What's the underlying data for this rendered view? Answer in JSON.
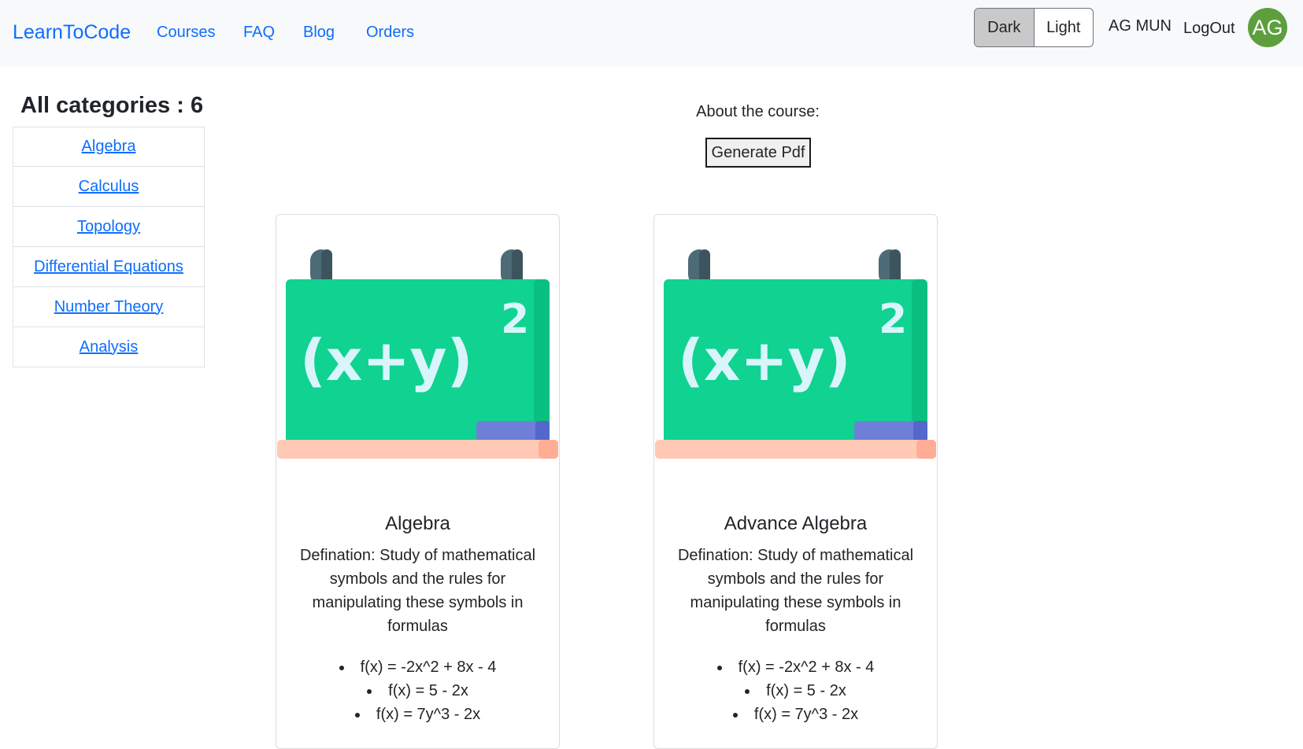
{
  "navbar": {
    "brand": "LearnToCode",
    "links": [
      "Courses",
      "FAQ",
      "Blog",
      "Orders"
    ],
    "theme_toggle": {
      "dark": "Dark",
      "light": "Light",
      "active": "Dark"
    },
    "user_name": "AG MUN",
    "logout": "LogOut",
    "avatar_initials": "AG",
    "avatar_color": "#5d9f3d"
  },
  "sidebar": {
    "title": "All categories : 6",
    "categories": [
      "Algebra",
      "Calculus",
      "Topology",
      "Differential Equations",
      "Number Theory",
      "Analysis"
    ]
  },
  "main": {
    "about_label": "About the course:",
    "pdf_button": "Generate Pdf",
    "cards": [
      {
        "title": "Algebra",
        "description": "Defination: Study of mathematical symbols and the rules for manipulating these symbols in formulas",
        "formulas": [
          "f(x) = -2x^2 + 8x - 4",
          "f(x) = 5 - 2x",
          "f(x) = 7y^3 - 2x"
        ],
        "image_icon": "chalkboard-equation-icon",
        "image_text": "(x+y)",
        "image_exponent": "2"
      },
      {
        "title": "Advance Algebra",
        "description": "Defination: Study of mathematical symbols and the rules for manipulating these symbols in formulas",
        "formulas": [
          "f(x) = -2x^2 + 8x - 4",
          "f(x) = 5 - 2x",
          "f(x) = 7y^3 - 2x"
        ],
        "image_icon": "chalkboard-equation-icon",
        "image_text": "(x+y)",
        "image_exponent": "2"
      }
    ]
  },
  "colors": {
    "link": "#0d6efd",
    "board_green": "#10d291",
    "board_dark_green": "#0ac080",
    "chalk": "#d9f5fb",
    "ledge": "#ffc9b5",
    "eraser": "#6f7fd8"
  }
}
